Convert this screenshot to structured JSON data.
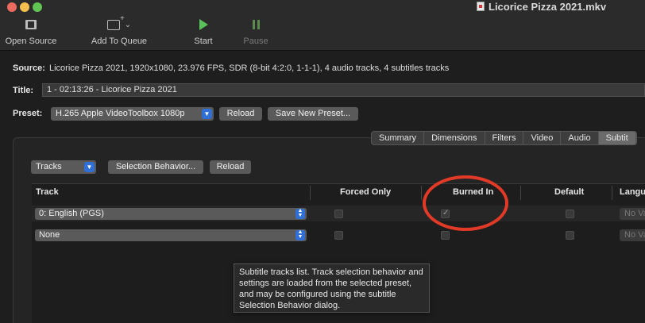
{
  "window": {
    "title": "Licorice Pizza 2021.mkv"
  },
  "toolbar": {
    "open_source": "Open Source",
    "add_to_queue": "Add To Queue",
    "start": "Start",
    "pause": "Pause"
  },
  "source": {
    "label": "Source:",
    "value": "Licorice Pizza 2021, 1920x1080, 23.976 FPS, SDR (8-bit 4:2:0, 1-1-1), 4 audio tracks, 4 subtitles tracks"
  },
  "title": {
    "label": "Title:",
    "value": "1 - 02:13:26 - Licorice Pizza 2021"
  },
  "preset": {
    "label": "Preset:",
    "value": "H.265 Apple VideoToolbox 1080p",
    "reload": "Reload",
    "save_new": "Save New Preset..."
  },
  "tabs": [
    "Summary",
    "Dimensions",
    "Filters",
    "Video",
    "Audio",
    "Subtit"
  ],
  "subtitles": {
    "tracks_popup": "Tracks",
    "selection_behavior": "Selection Behavior...",
    "reload": "Reload",
    "columns": {
      "track": "Track",
      "forced_only": "Forced Only",
      "burned_in": "Burned In",
      "default": "Default",
      "language": "Langu"
    },
    "rows": [
      {
        "track": "0: English (PGS)",
        "forced_only": false,
        "burned_in": true,
        "default": false,
        "language": "No Va"
      },
      {
        "track": "None",
        "forced_only": false,
        "burned_in": false,
        "default": false,
        "language": "No Va"
      }
    ],
    "tooltip": "Subtitle tracks list. Track selection behavior and settings are loaded from the selected preset, and may be configured using the subtitle Selection Behavior dialog."
  },
  "colors": {
    "accent_blue": "#2f6fd6",
    "start_green": "#5ac25b",
    "annotation_red": "#e23a26"
  }
}
